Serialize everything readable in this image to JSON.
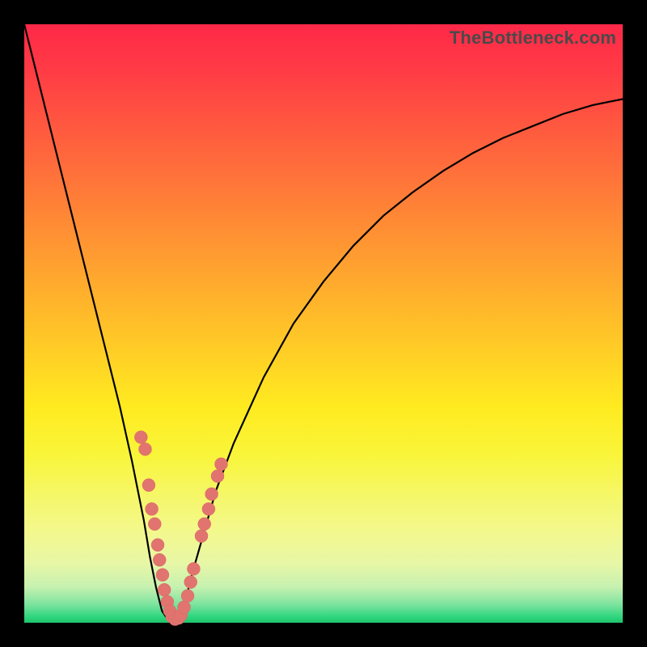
{
  "watermark": "TheBottleneck.com",
  "colors": {
    "frame": "#000000",
    "curve": "#000000",
    "marker_fill": "#e2746f",
    "marker_stroke": "#d76a65"
  },
  "chart_data": {
    "type": "line",
    "title": "",
    "xlabel": "",
    "ylabel": "",
    "xlim": [
      0,
      100
    ],
    "ylim": [
      0,
      100
    ],
    "series": [
      {
        "name": "bottleneck-curve",
        "x": [
          0,
          2,
          4,
          6,
          8,
          10,
          12,
          14,
          16,
          18,
          20,
          21,
          22,
          23,
          24,
          25,
          26,
          27,
          28,
          30,
          32,
          35,
          40,
          45,
          50,
          55,
          60,
          65,
          70,
          75,
          80,
          85,
          90,
          95,
          100
        ],
        "y": [
          100,
          92,
          84,
          76,
          68,
          60,
          52,
          44,
          36,
          27,
          17,
          11,
          6,
          2,
          0.5,
          0,
          1,
          4,
          8,
          15,
          22,
          30,
          41,
          50,
          57,
          63,
          68,
          72,
          75.5,
          78.5,
          81,
          83,
          85,
          86.5,
          87.5
        ]
      }
    ],
    "markers": [
      {
        "x": 19.5,
        "y": 31
      },
      {
        "x": 20.2,
        "y": 29
      },
      {
        "x": 20.8,
        "y": 23
      },
      {
        "x": 21.3,
        "y": 19
      },
      {
        "x": 21.8,
        "y": 16.5
      },
      {
        "x": 22.3,
        "y": 13
      },
      {
        "x": 22.6,
        "y": 10.5
      },
      {
        "x": 23.1,
        "y": 8
      },
      {
        "x": 23.4,
        "y": 5.5
      },
      {
        "x": 23.9,
        "y": 3.5
      },
      {
        "x": 24.3,
        "y": 2
      },
      {
        "x": 24.7,
        "y": 1
      },
      {
        "x": 25.2,
        "y": 0.6
      },
      {
        "x": 25.8,
        "y": 0.8
      },
      {
        "x": 26.2,
        "y": 1.3
      },
      {
        "x": 26.7,
        "y": 2.6
      },
      {
        "x": 27.3,
        "y": 4.5
      },
      {
        "x": 27.8,
        "y": 6.8
      },
      {
        "x": 28.3,
        "y": 9
      },
      {
        "x": 29.6,
        "y": 14.5
      },
      {
        "x": 30.1,
        "y": 16.5
      },
      {
        "x": 30.8,
        "y": 19
      },
      {
        "x": 31.3,
        "y": 21.5
      },
      {
        "x": 32.3,
        "y": 24.5
      },
      {
        "x": 32.9,
        "y": 26.5
      }
    ],
    "marker_radius_px": 8
  }
}
